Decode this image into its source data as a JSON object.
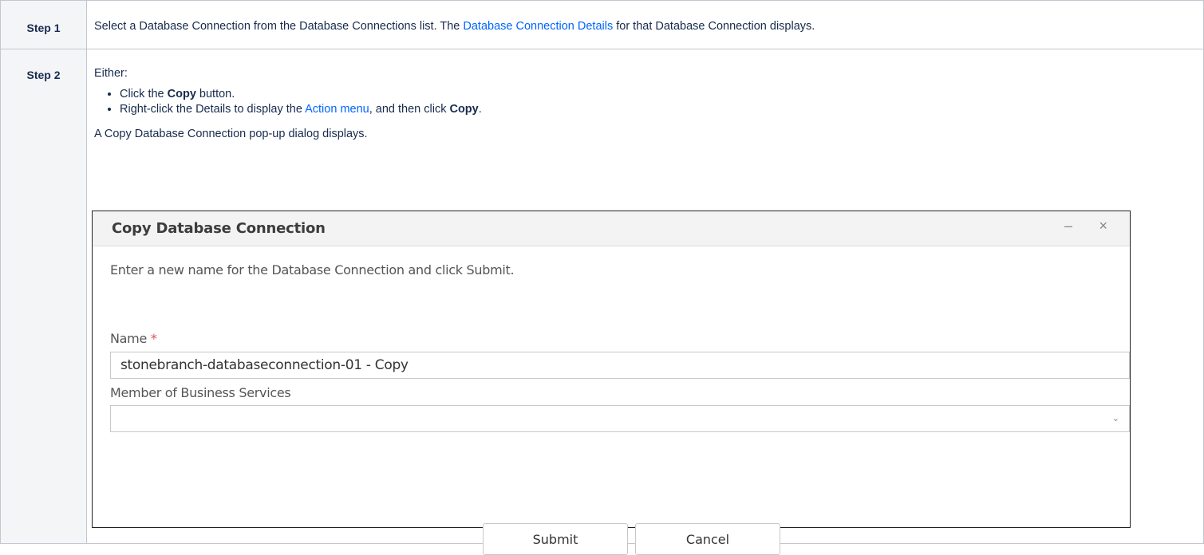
{
  "steps": [
    {
      "label": "Step 1",
      "text_before": "Select a Database Connection from the Database Connections list. The ",
      "link": "Database Connection Details",
      "text_after": " for that Database Connection displays."
    },
    {
      "label": "Step 2",
      "intro": "Either:",
      "bullets": [
        {
          "before": "Click the ",
          "bold": "Copy",
          "after": " button."
        },
        {
          "before": "Right-click the Details to display the ",
          "link": "Action menu",
          "middle": ", and then click ",
          "bold": "Copy",
          "after": "."
        }
      ],
      "after": "A Copy Database Connection pop-up dialog displays."
    }
  ],
  "dialog": {
    "title": "Copy Database Connection",
    "minimize_glyph": "–",
    "close_glyph": "×",
    "instruction": "Enter a new name for the Database Connection and click Submit.",
    "name_label": "Name",
    "required_mark": "*",
    "name_value": "stonebranch-databaseconnection-01 - Copy",
    "business_services_label": "Member of Business Services",
    "business_services_value": "",
    "submit_label": "Submit",
    "cancel_label": "Cancel"
  },
  "colors": {
    "link": "#0065ff",
    "required": "#e05050",
    "label_bg": "#f4f5f7"
  }
}
